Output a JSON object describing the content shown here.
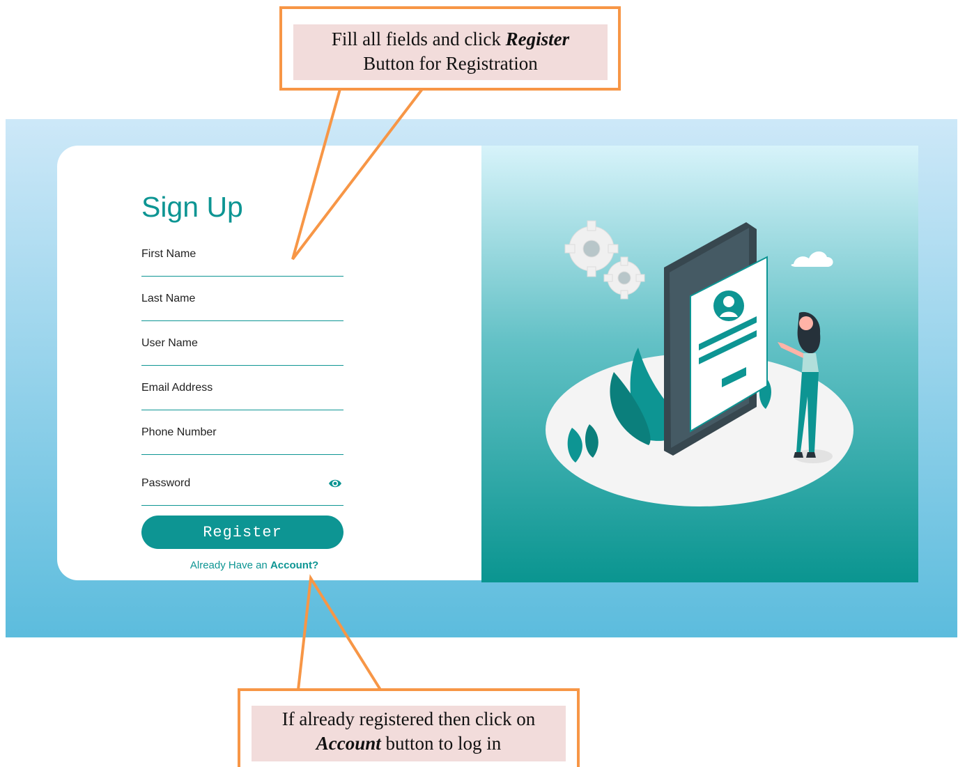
{
  "form": {
    "title": "Sign Up",
    "fields": [
      {
        "label": "First Name"
      },
      {
        "label": "Last Name"
      },
      {
        "label": "User Name"
      },
      {
        "label": "Email Address"
      },
      {
        "label": "Phone Number"
      },
      {
        "label": "Password"
      }
    ],
    "register_label": "Register",
    "account_prefix": "Already Have an ",
    "account_link": "Account?"
  },
  "callouts": {
    "top": {
      "line1_pre": "Fill all fields and click ",
      "line1_em": "Register",
      "line2": "Button for Registration"
    },
    "bottom": {
      "line1": "If already registered then click on",
      "line2_em": "Account",
      "line2_post": " button to log in"
    }
  },
  "colors": {
    "accent": "#0d9593",
    "callout_border": "#f79646",
    "callout_fill": "#f2dcdb"
  },
  "icons": [
    "eye-icon",
    "gear-icon",
    "cloud-icon",
    "phone-illustration",
    "person-illustration"
  ]
}
